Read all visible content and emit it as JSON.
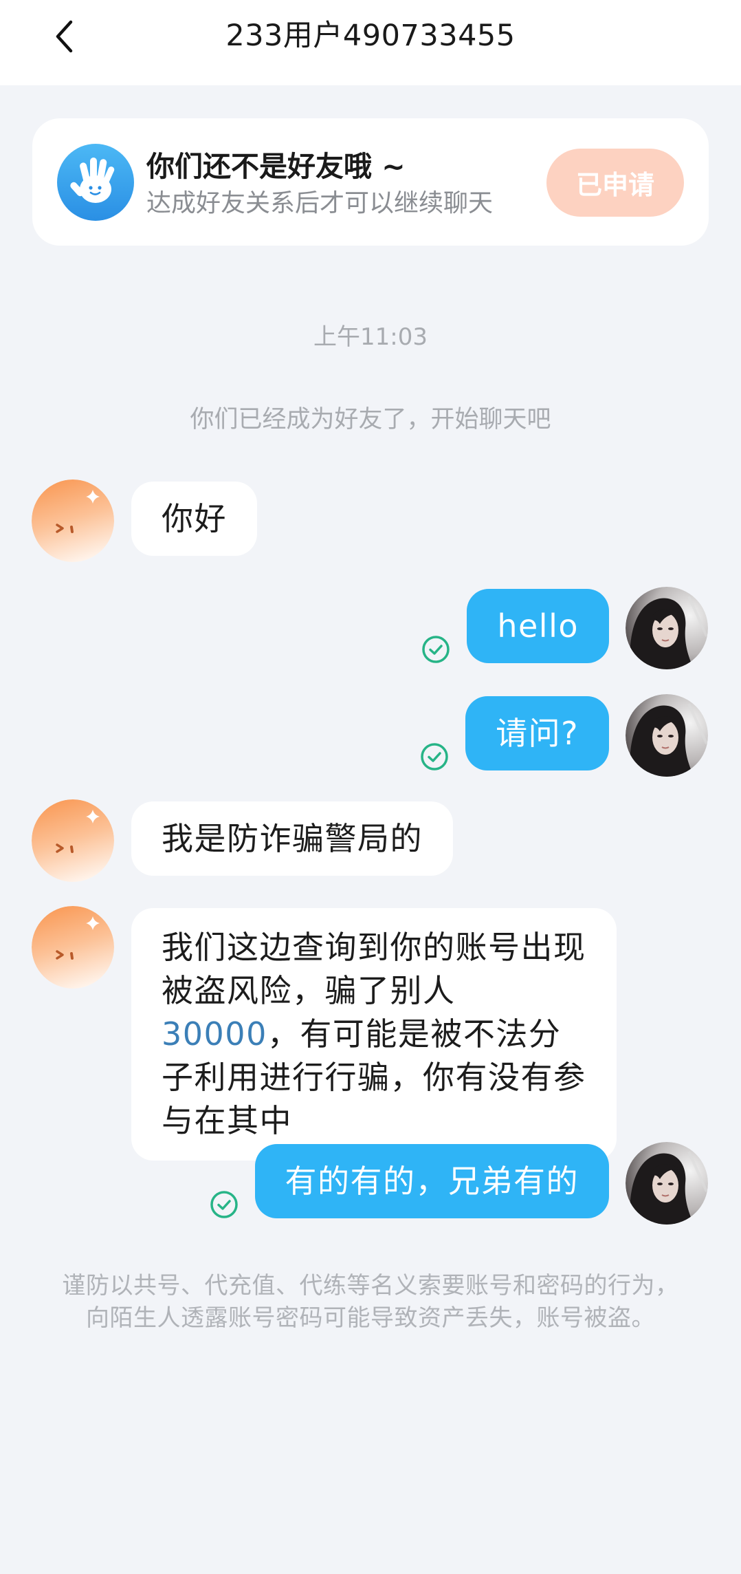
{
  "header": {
    "back_icon": "chevron-left-icon",
    "title": "233用户490733455"
  },
  "friend_notice": {
    "icon": "hand-wave-icon",
    "title": "你们还不是好友哦 ~",
    "subtitle": "达成好友关系后才可以继续聊天",
    "button_label": "已申请"
  },
  "chat": {
    "timestamp": "上午11:03",
    "system_message": "你们已经成为好友了，开始聊天吧",
    "messages": [
      {
        "text": "你好"
      },
      {
        "text": "hello",
        "status_icon": "check-circle-icon"
      },
      {
        "text": "请问?",
        "status_icon": "check-circle-icon"
      },
      {
        "text": "我是防诈骗警局的"
      },
      {
        "text_before": "我们这边查询到你的账号出现被盗风险，骗了别人",
        "highlight": "30000",
        "text_after": "，有可能是被不法分子利用进行行骗，你有没有参与在其中"
      },
      {
        "text": "有的有的，兄弟有的",
        "status_icon": "check-circle-icon"
      }
    ]
  },
  "footer_notice": {
    "lines": [
      "谨防以共号、代充值、代练等名义索要账号和密码的行为，",
      "向陌生人透露账号密码可能导致资产丢失，账号被盗。"
    ]
  },
  "colors": {
    "page_background": "#f2f4f8",
    "sent_bubble": "#2fb4f6",
    "received_bubble": "#ffffff",
    "highlight_text": "#3b7fb7",
    "read_check": "#27b487",
    "applied_button": "#fdd2c1",
    "notice_icon": "#2f9fea"
  }
}
